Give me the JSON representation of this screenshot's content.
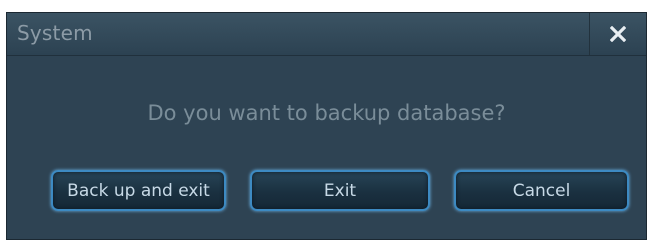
{
  "dialog": {
    "title": "System",
    "close_icon": "close-x-icon",
    "message": "Do you want to backup database?",
    "buttons": {
      "backup_exit": "Back up and exit",
      "exit": "Exit",
      "cancel": "Cancel"
    }
  },
  "colors": {
    "dialog_bg": "#2e4353",
    "button_border": "#3d8ac2",
    "text_muted": "#7a8d99"
  }
}
